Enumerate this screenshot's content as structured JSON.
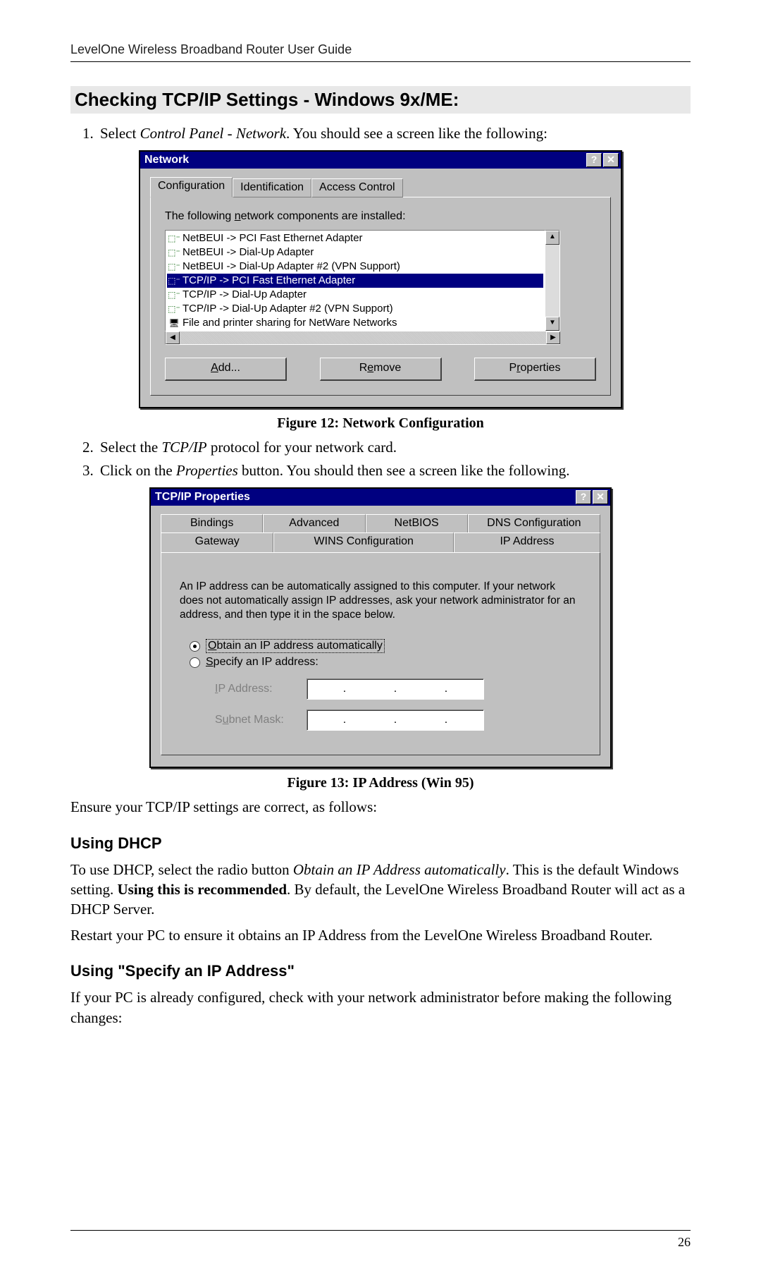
{
  "header": "LevelOne Wireless Broadband Router User Guide",
  "page_number": "26",
  "heading_main": "Checking TCP/IP Settings - Windows 9x/ME:",
  "step1_prefix": "Select ",
  "step1_italic": "Control Panel - Network",
  "step1_suffix": ". You should see a screen like the following:",
  "step2_prefix": "Select the ",
  "step2_italic": "TCP/IP",
  "step2_suffix": " protocol for your network card.",
  "step3_prefix": "Click on the ",
  "step3_italic": "Properties",
  "step3_suffix": " button. You should then see a screen like the following.",
  "fig12_caption": "Figure 12: Network Configuration",
  "fig13_caption": "Figure 13: IP Address (Win 95)",
  "ensure_text": "Ensure your TCP/IP settings are correct, as follows:",
  "dhcp_heading": "Using DHCP",
  "dhcp_p1_a": "To use DHCP, select the radio button ",
  "dhcp_p1_italic": "Obtain an IP Address automatically",
  "dhcp_p1_b": ". This is the default Windows setting. ",
  "dhcp_p1_bold": "Using this is recommended",
  "dhcp_p1_c": ". By default, the LevelOne Wireless Broadband Router will act as a DHCP Server.",
  "dhcp_p2": "Restart your PC to ensure it obtains an IP Address from the LevelOne Wireless Broadband Router.",
  "specify_heading": "Using \"Specify an IP Address\"",
  "specify_p1": "If your PC is already configured, check with your network administrator before making the following changes:",
  "dlg1": {
    "title": "Network",
    "help_btn": "?",
    "close_btn": "✕",
    "tabs": [
      "Configuration",
      "Identification",
      "Access Control"
    ],
    "label_prefix": "The following ",
    "label_under": "n",
    "label_suffix": "etwork components are installed:",
    "items": [
      "NetBEUI -> PCI Fast Ethernet Adapter",
      "NetBEUI -> Dial-Up Adapter",
      "NetBEUI -> Dial-Up Adapter #2 (VPN Support)",
      "TCP/IP -> PCI Fast Ethernet Adapter",
      "TCP/IP -> Dial-Up Adapter",
      "TCP/IP -> Dial-Up Adapter #2 (VPN Support)",
      "File and printer sharing for NetWare Networks"
    ],
    "selected_index": 3,
    "btn_add_u": "A",
    "btn_add_rest": "dd...",
    "btn_remove_pre": "R",
    "btn_remove_u": "e",
    "btn_remove_rest": "move",
    "btn_props_pre": "P",
    "btn_props_u": "r",
    "btn_props_rest": "operties"
  },
  "dlg2": {
    "title": "TCP/IP Properties",
    "help_btn": "?",
    "close_btn": "✕",
    "tabs_row1": [
      "Bindings",
      "Advanced",
      "NetBIOS",
      "DNS Configuration"
    ],
    "tabs_row2": [
      "Gateway",
      "WINS Configuration",
      "IP Address"
    ],
    "help_text": "An IP address can be automatically assigned to this computer. If your network does not automatically assign IP addresses, ask your network administrator for an address, and then type it in the space below.",
    "radio1_u": "O",
    "radio1_rest": "btain an IP address automatically",
    "radio2_u": "S",
    "radio2_rest": "pecify an IP address:",
    "label_ip_u": "I",
    "label_ip_rest": "P Address:",
    "label_sm_pre": "S",
    "label_sm_u": "u",
    "label_sm_rest": "bnet Mask:"
  }
}
